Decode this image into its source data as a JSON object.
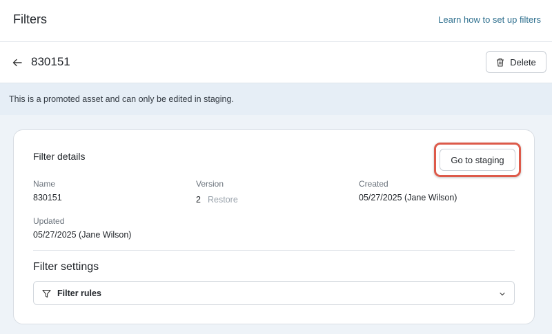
{
  "header": {
    "title": "Filters",
    "help_link": "Learn how to set up filters"
  },
  "subheader": {
    "asset_id": "830151",
    "delete_label": "Delete"
  },
  "banner": {
    "message": "This is a promoted asset and can only be edited in staging."
  },
  "card": {
    "title": "Filter details",
    "staging_button": "Go to staging",
    "fields": {
      "name_label": "Name",
      "name_value": "830151",
      "version_label": "Version",
      "version_value": "2",
      "restore_label": "Restore",
      "created_label": "Created",
      "created_value": "05/27/2025 (Jane Wilson)",
      "updated_label": "Updated",
      "updated_value": "05/27/2025 (Jane Wilson)"
    },
    "settings_title": "Filter settings",
    "filter_rules_label": "Filter rules"
  },
  "colors": {
    "highlight": "#dd5a4a",
    "link": "#2e6f8e",
    "banner_bg": "#e6eef6"
  },
  "icons": {
    "back": "arrow-left-icon",
    "delete": "trash-icon",
    "filter": "funnel-icon",
    "expand": "chevron-down-icon"
  }
}
